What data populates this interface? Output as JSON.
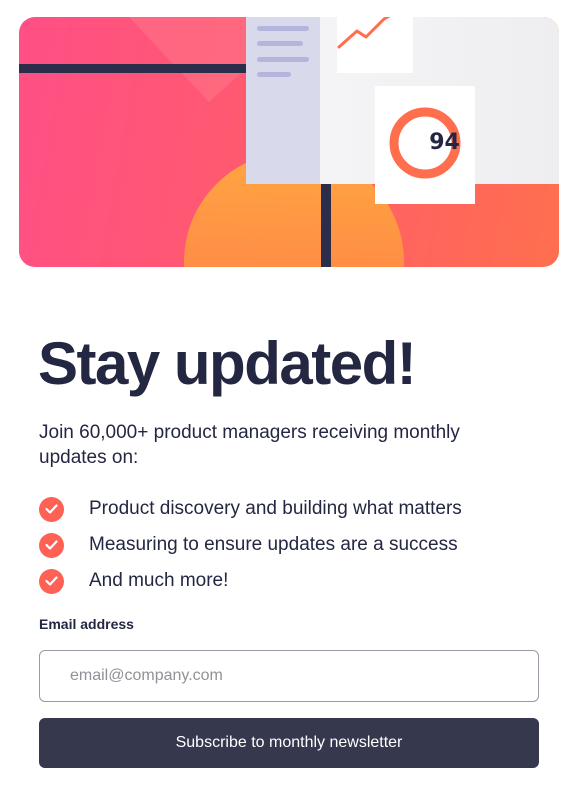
{
  "illustration": {
    "score_value": "94",
    "colors": {
      "pink": "#ff4f86",
      "coral": "#ff6f4e",
      "orange": "#ff9a3c",
      "navy": "#242742",
      "card": "#f2f2f4"
    }
  },
  "content": {
    "title": "Stay updated!",
    "intro": "Join 60,000+ product managers receiving monthly updates on:",
    "features": [
      "Product discovery and building what matters",
      "Measuring to ensure updates are a success",
      "And much more!"
    ],
    "check_icon": "check-circle-icon",
    "accent_color": "#ff6155"
  },
  "form": {
    "email_label": "Email address",
    "email_placeholder": "email@company.com",
    "email_value": "",
    "submit_label": "Subscribe to monthly newsletter",
    "button_color": "#36384e"
  }
}
